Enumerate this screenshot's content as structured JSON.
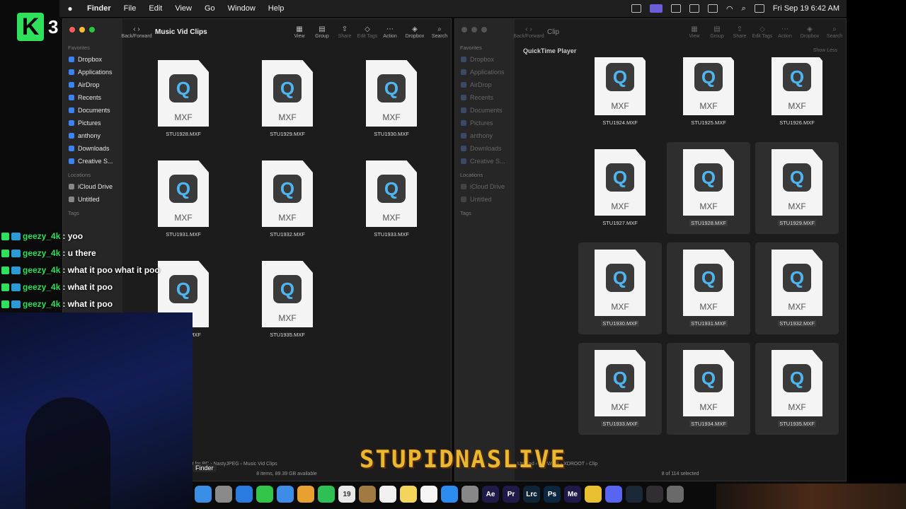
{
  "menubar": {
    "app": "Finder",
    "items": [
      "File",
      "Edit",
      "View",
      "Go",
      "Window",
      "Help"
    ],
    "datetime": "Fri Sep 19  6:42 AM"
  },
  "overlay": {
    "logo_number": "3",
    "chat": [
      {
        "user": "geezy_4k",
        "msg": ": yoo"
      },
      {
        "user": "geezy_4k",
        "msg": ": u there"
      },
      {
        "user": "geezy_4k",
        "msg": ": what it poo what it poo"
      },
      {
        "user": "geezy_4k",
        "msg": ": what it poo"
      },
      {
        "user": "geezy_4k",
        "msg": ": what it poo"
      }
    ],
    "watermark": "STUPIDNASLIVE"
  },
  "left_window": {
    "title": "Music Vid Clips",
    "toolbar": {
      "back_forward": "Back/Forward",
      "view": "View",
      "group": "Group",
      "share": "Share",
      "edit_tags": "Edit Tags",
      "action": "Action",
      "dropbox": "Dropbox",
      "search": "Search"
    },
    "sidebar": {
      "favorites_label": "Favorites",
      "favorites": [
        "Dropbox",
        "Applications",
        "AirDrop",
        "Recents",
        "Documents",
        "Pictures",
        "anthony",
        "Downloads",
        "Creative S..."
      ],
      "locations_label": "Locations",
      "locations": [
        "iCloud Drive",
        "Untitled"
      ],
      "tags_label": "Tags"
    },
    "files": [
      "STU1928.MXF",
      "STU1929.MXF",
      "STU1930.MXF",
      "STU1931.MXF",
      "STU1932.MXF",
      "STU1933.MXF",
      "STU1934.MXF",
      "STU1935.MXF"
    ],
    "file_ext": "MXF",
    "path": "anthony  ›  Downloads  ›  Content for PC  ›  NastyJPEG  ›  Music Vid Clips",
    "status": "8 items, 89.39 GB available"
  },
  "right_window": {
    "title": "Clip",
    "section": "QuickTime Player",
    "show_less": "Show Less",
    "toolbar": {
      "back_forward": "Back/Forward",
      "view": "View",
      "group": "Group",
      "share": "Share",
      "edit_tags": "Edit Tags",
      "action": "Action",
      "dropbox": "Dropbox",
      "search": "Search"
    },
    "sidebar": {
      "favorites_label": "Favorites",
      "favorites": [
        "Dropbox",
        "Applications",
        "AirDrop",
        "Recents",
        "Documents",
        "Pictures",
        "anthony",
        "Downloads",
        "Creative S..."
      ],
      "locations_label": "Locations",
      "locations": [
        "iCloud Drive",
        "Untitled"
      ],
      "tags_label": "Tags"
    },
    "files": [
      "STU1924.MXF",
      "STU1925.MXF",
      "STU1926.MXF",
      "STU1927.MXF",
      "STU1928.MXF",
      "STU1929.MXF",
      "STU1930.MXF",
      "STU1931.MXF",
      "STU1932.MXF",
      "STU1933.MXF",
      "STU1934.MXF",
      "STU1935.MXF"
    ],
    "selected": [
      false,
      false,
      false,
      false,
      true,
      true,
      true,
      true,
      true,
      true,
      true,
      true
    ],
    "file_ext": "MXF",
    "path": "Untitled  ›  PRIVATE  ›  XDROOT  ›  Clip",
    "status": "8 of 114 selected"
  },
  "dock": {
    "tooltip": "Finder",
    "apps": [
      {
        "name": "finder",
        "label": "",
        "color": "#3a8ee6"
      },
      {
        "name": "launchpad",
        "label": "",
        "color": "#8a8a8a"
      },
      {
        "name": "safari",
        "label": "",
        "color": "#2a7be0"
      },
      {
        "name": "messages",
        "label": "",
        "color": "#33c44a"
      },
      {
        "name": "mail",
        "label": "",
        "color": "#3d8ce8"
      },
      {
        "name": "photos",
        "label": "",
        "color": "#e8a030"
      },
      {
        "name": "facetime",
        "label": "",
        "color": "#2fc055"
      },
      {
        "name": "calendar",
        "label": "19",
        "color": "#e8e8e8"
      },
      {
        "name": "archive",
        "label": "",
        "color": "#a07a40"
      },
      {
        "name": "reminders",
        "label": "",
        "color": "#f0f0f0"
      },
      {
        "name": "notes",
        "label": "",
        "color": "#f2d55a"
      },
      {
        "name": "freeform",
        "label": "",
        "color": "#f5f5f5"
      },
      {
        "name": "app-store",
        "label": "",
        "color": "#2b8df0"
      },
      {
        "name": "system-settings",
        "label": "",
        "color": "#888888"
      },
      {
        "name": "after-effects",
        "label": "Ae",
        "color": "#1f1a4a"
      },
      {
        "name": "premiere",
        "label": "Pr",
        "color": "#1f1a4a"
      },
      {
        "name": "lightroom-classic",
        "label": "Lrc",
        "color": "#0e2438"
      },
      {
        "name": "photoshop",
        "label": "Ps",
        "color": "#0c2640"
      },
      {
        "name": "media-encoder",
        "label": "Me",
        "color": "#1f1a4a"
      },
      {
        "name": "chrome",
        "label": "",
        "color": "#e8c030"
      },
      {
        "name": "discord",
        "label": "",
        "color": "#5865f2"
      },
      {
        "name": "steam",
        "label": "",
        "color": "#1b2838"
      },
      {
        "name": "obs",
        "label": "",
        "color": "#302e31"
      },
      {
        "name": "trash",
        "label": "",
        "color": "#6a6a6a"
      }
    ]
  }
}
